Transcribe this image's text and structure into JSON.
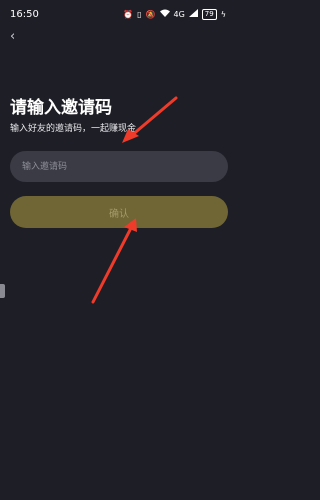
{
  "status_bar": {
    "time": "16:50",
    "icons": [
      "alarm-icon",
      "vibrate-icon",
      "mute-icon",
      "wifi-icon",
      "signal-icon",
      "charging-icon"
    ],
    "network_label": "4G",
    "battery_level": "79"
  },
  "nav": {
    "back_icon": "back-chevron-icon"
  },
  "page": {
    "title": "请输入邀请码",
    "subtitle": "输入好友的邀请码，一起赚现金"
  },
  "invite_input": {
    "value": "",
    "placeholder": "输入邀请码"
  },
  "confirm_button": {
    "label": "确认"
  },
  "colors": {
    "background": "#1e1e26",
    "input_bg": "#3a3b44",
    "button_bg": "#6f6535",
    "button_text": "#a59a68",
    "annotation_arrow": "#ee3b2a"
  }
}
